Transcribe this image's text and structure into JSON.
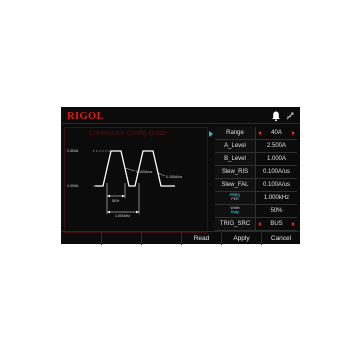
{
  "header": {
    "logo": "RIGOL"
  },
  "diagram": {
    "title": "Continuous Config Guide",
    "labels": {
      "a_level": "2.500A",
      "b_level": "1.000A",
      "slew_rise": "0.100A/us",
      "slew_fall": "0.100A/us",
      "width": "50%",
      "freq": "1.000kHz"
    }
  },
  "params": [
    {
      "name": "Range",
      "value": "40A"
    },
    {
      "name": "A_Level",
      "value": "2.500A"
    },
    {
      "name": "B_Level",
      "value": "1.000A"
    },
    {
      "name": "Slew_RIS",
      "value": "0.100A/us"
    },
    {
      "name": "Slew_FAL",
      "value": "0.100A/us"
    },
    {
      "name": "mode",
      "value": "1.000kHz",
      "modes": [
        "FREQ",
        "PER"
      ]
    },
    {
      "name": "mode2",
      "value": "50%",
      "modes": [
        "Width",
        "Duty"
      ]
    },
    {
      "name": "TRIG_SRC",
      "value": "BUS"
    }
  ],
  "softkeys": [
    "",
    "",
    "",
    "Read",
    "Apply",
    "Cancel"
  ],
  "colors": {
    "accent": "#e11b1b",
    "highlight": "#19c6d6",
    "background": "#0b0b0b"
  }
}
